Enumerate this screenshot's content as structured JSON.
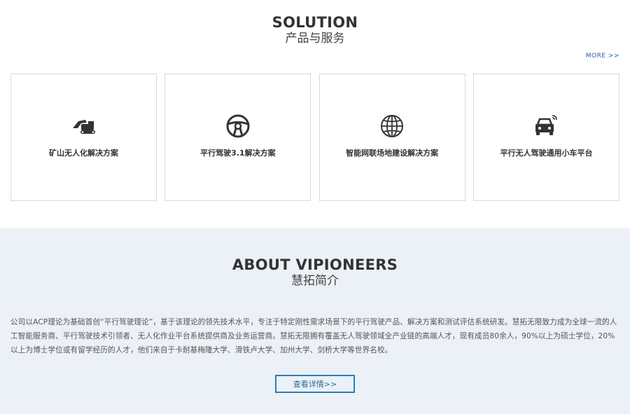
{
  "solution": {
    "title": "SOLUTION",
    "subtitle": "产品与服务",
    "more_label": "MORE  >>",
    "cards": [
      {
        "label": "矿山无人化解决方案",
        "icon": "excavator-icon"
      },
      {
        "label": "平行驾驶3.1解决方案",
        "icon": "steering-wheel-icon"
      },
      {
        "label": "智能网联场地建设解决方案",
        "icon": "globe-icon"
      },
      {
        "label": "平行无人驾驶通用小车平台",
        "icon": "connected-car-icon"
      }
    ]
  },
  "about": {
    "title": "ABOUT VIPIONEERS",
    "subtitle": "慧拓简介",
    "text": "公司以ACP理论为基础首创“平行驾驶理论”，基于该理论的领先技术水平，专注于特定刚性需求场景下的平行驾驶产品、解决方案和测试评估系统研发。慧拓无限致力成为全球一流的人工智能服务商、平行驾驶技术引领者、无人化作业平台系统提供商及业务运营商。慧拓无限拥有覆盖无人驾驶领域全产业链的高端人才，现有成员80余人，90%以上为硕士学位，20%以上为博士学位或有留学经历的人才，他们来自于卡耐基梅隆大学、滑铁卢大学、加州大学、剑桥大学等世界名校。",
    "button_label": "查看详情>>"
  }
}
